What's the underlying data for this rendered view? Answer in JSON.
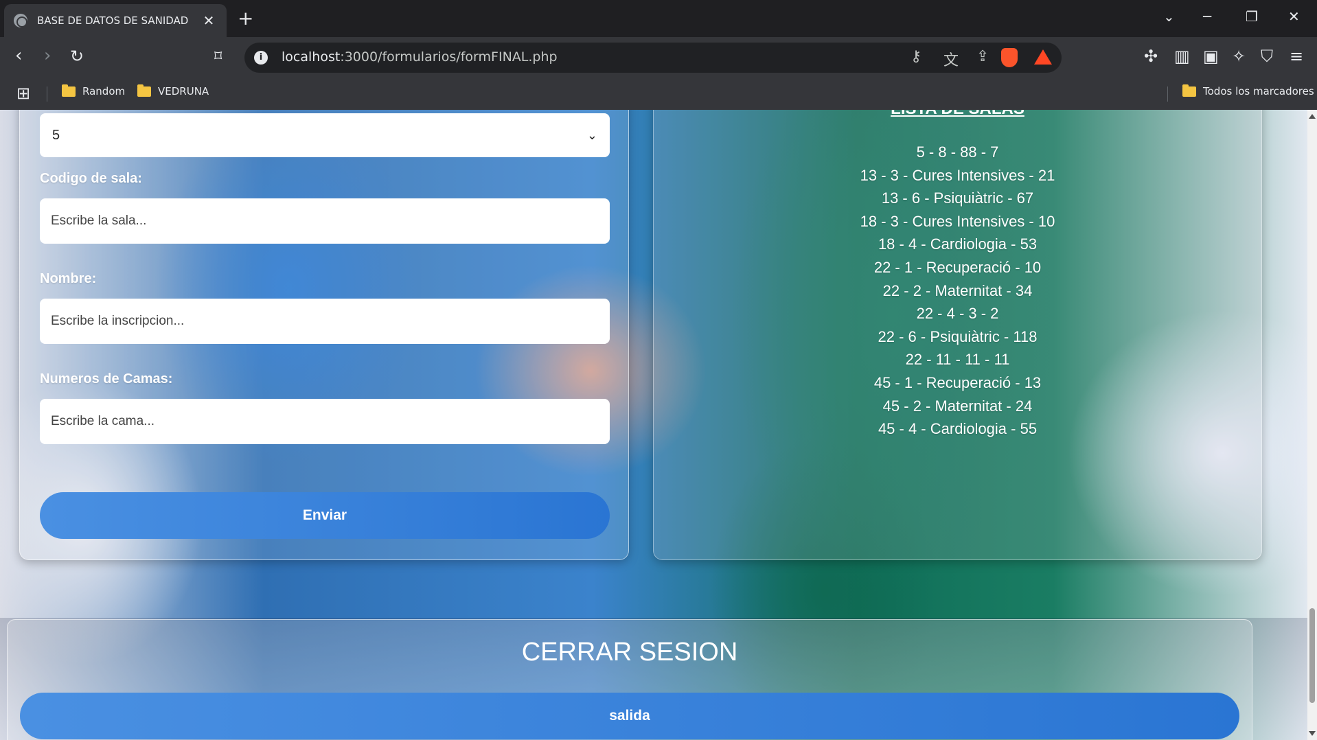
{
  "browser": {
    "tab_title": "BASE DE DATOS DE SANIDAD",
    "url_host": "localhost",
    "url_rest": ":3000/formularios/formFINAL.php",
    "bookmarks": [
      "Random",
      "VEDRUNA"
    ],
    "all_bookmarks_label": "Todos los marcadores"
  },
  "form": {
    "selected_value": "5",
    "sala_label": "Codigo de sala:",
    "sala_placeholder": "Escribe la sala...",
    "nombre_label": "Nombre:",
    "nombre_placeholder": "Escribe la inscripcion...",
    "camas_label": "Numeros de Camas:",
    "camas_placeholder": "Escribe la cama...",
    "submit_label": "Enviar"
  },
  "list": {
    "title": "LISTA DE SALAS",
    "items": [
      "5 - 8 - 88 - 7",
      "13 - 3 - Cures Intensives - 21",
      "13 - 6 - Psiquiàtric - 67",
      "18 - 3 - Cures Intensives - 10",
      "18 - 4 - Cardiologia - 53",
      "22 - 1 - Recuperació - 10",
      "22 - 2 - Maternitat - 34",
      "22 - 4 - 3 - 2",
      "22 - 6 - Psiquiàtric - 118",
      "22 - 11 - 11 - 11",
      "45 - 1 - Recuperació - 13",
      "45 - 2 - Maternitat - 24",
      "45 - 4 - Cardiologia - 55"
    ]
  },
  "logout": {
    "title": "CERRAR SESION",
    "button_label": "salida"
  },
  "colors": {
    "accent": "#2a75d3",
    "chrome_dark": "#35363a"
  }
}
